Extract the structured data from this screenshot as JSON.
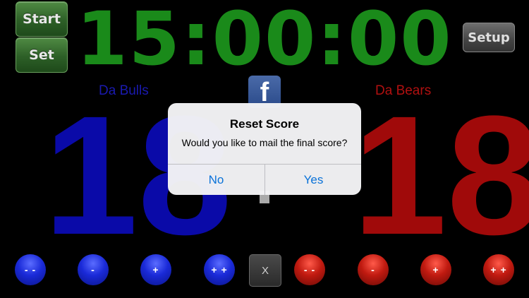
{
  "controls": {
    "start_label": "Start",
    "set_label": "Set",
    "setup_label": "Setup"
  },
  "clock": {
    "time": "15:00:00"
  },
  "home": {
    "name": "Da Bulls",
    "score": "18",
    "color": "#0a0aa8"
  },
  "away": {
    "name": "Da Bears",
    "score": "18",
    "color": "#a00a0a"
  },
  "social": {
    "facebook_icon": "facebook-icon",
    "glyph": "f"
  },
  "score_buttons": {
    "home": [
      "- -",
      "-",
      "+",
      "+ +"
    ],
    "clear": "X",
    "away": [
      "- -",
      "-",
      "+",
      "+ +"
    ]
  },
  "dialog": {
    "title": "Reset Score",
    "message": "Would you like to mail the final score?",
    "no_label": "No",
    "yes_label": "Yes",
    "accent": "#0a72d8"
  }
}
